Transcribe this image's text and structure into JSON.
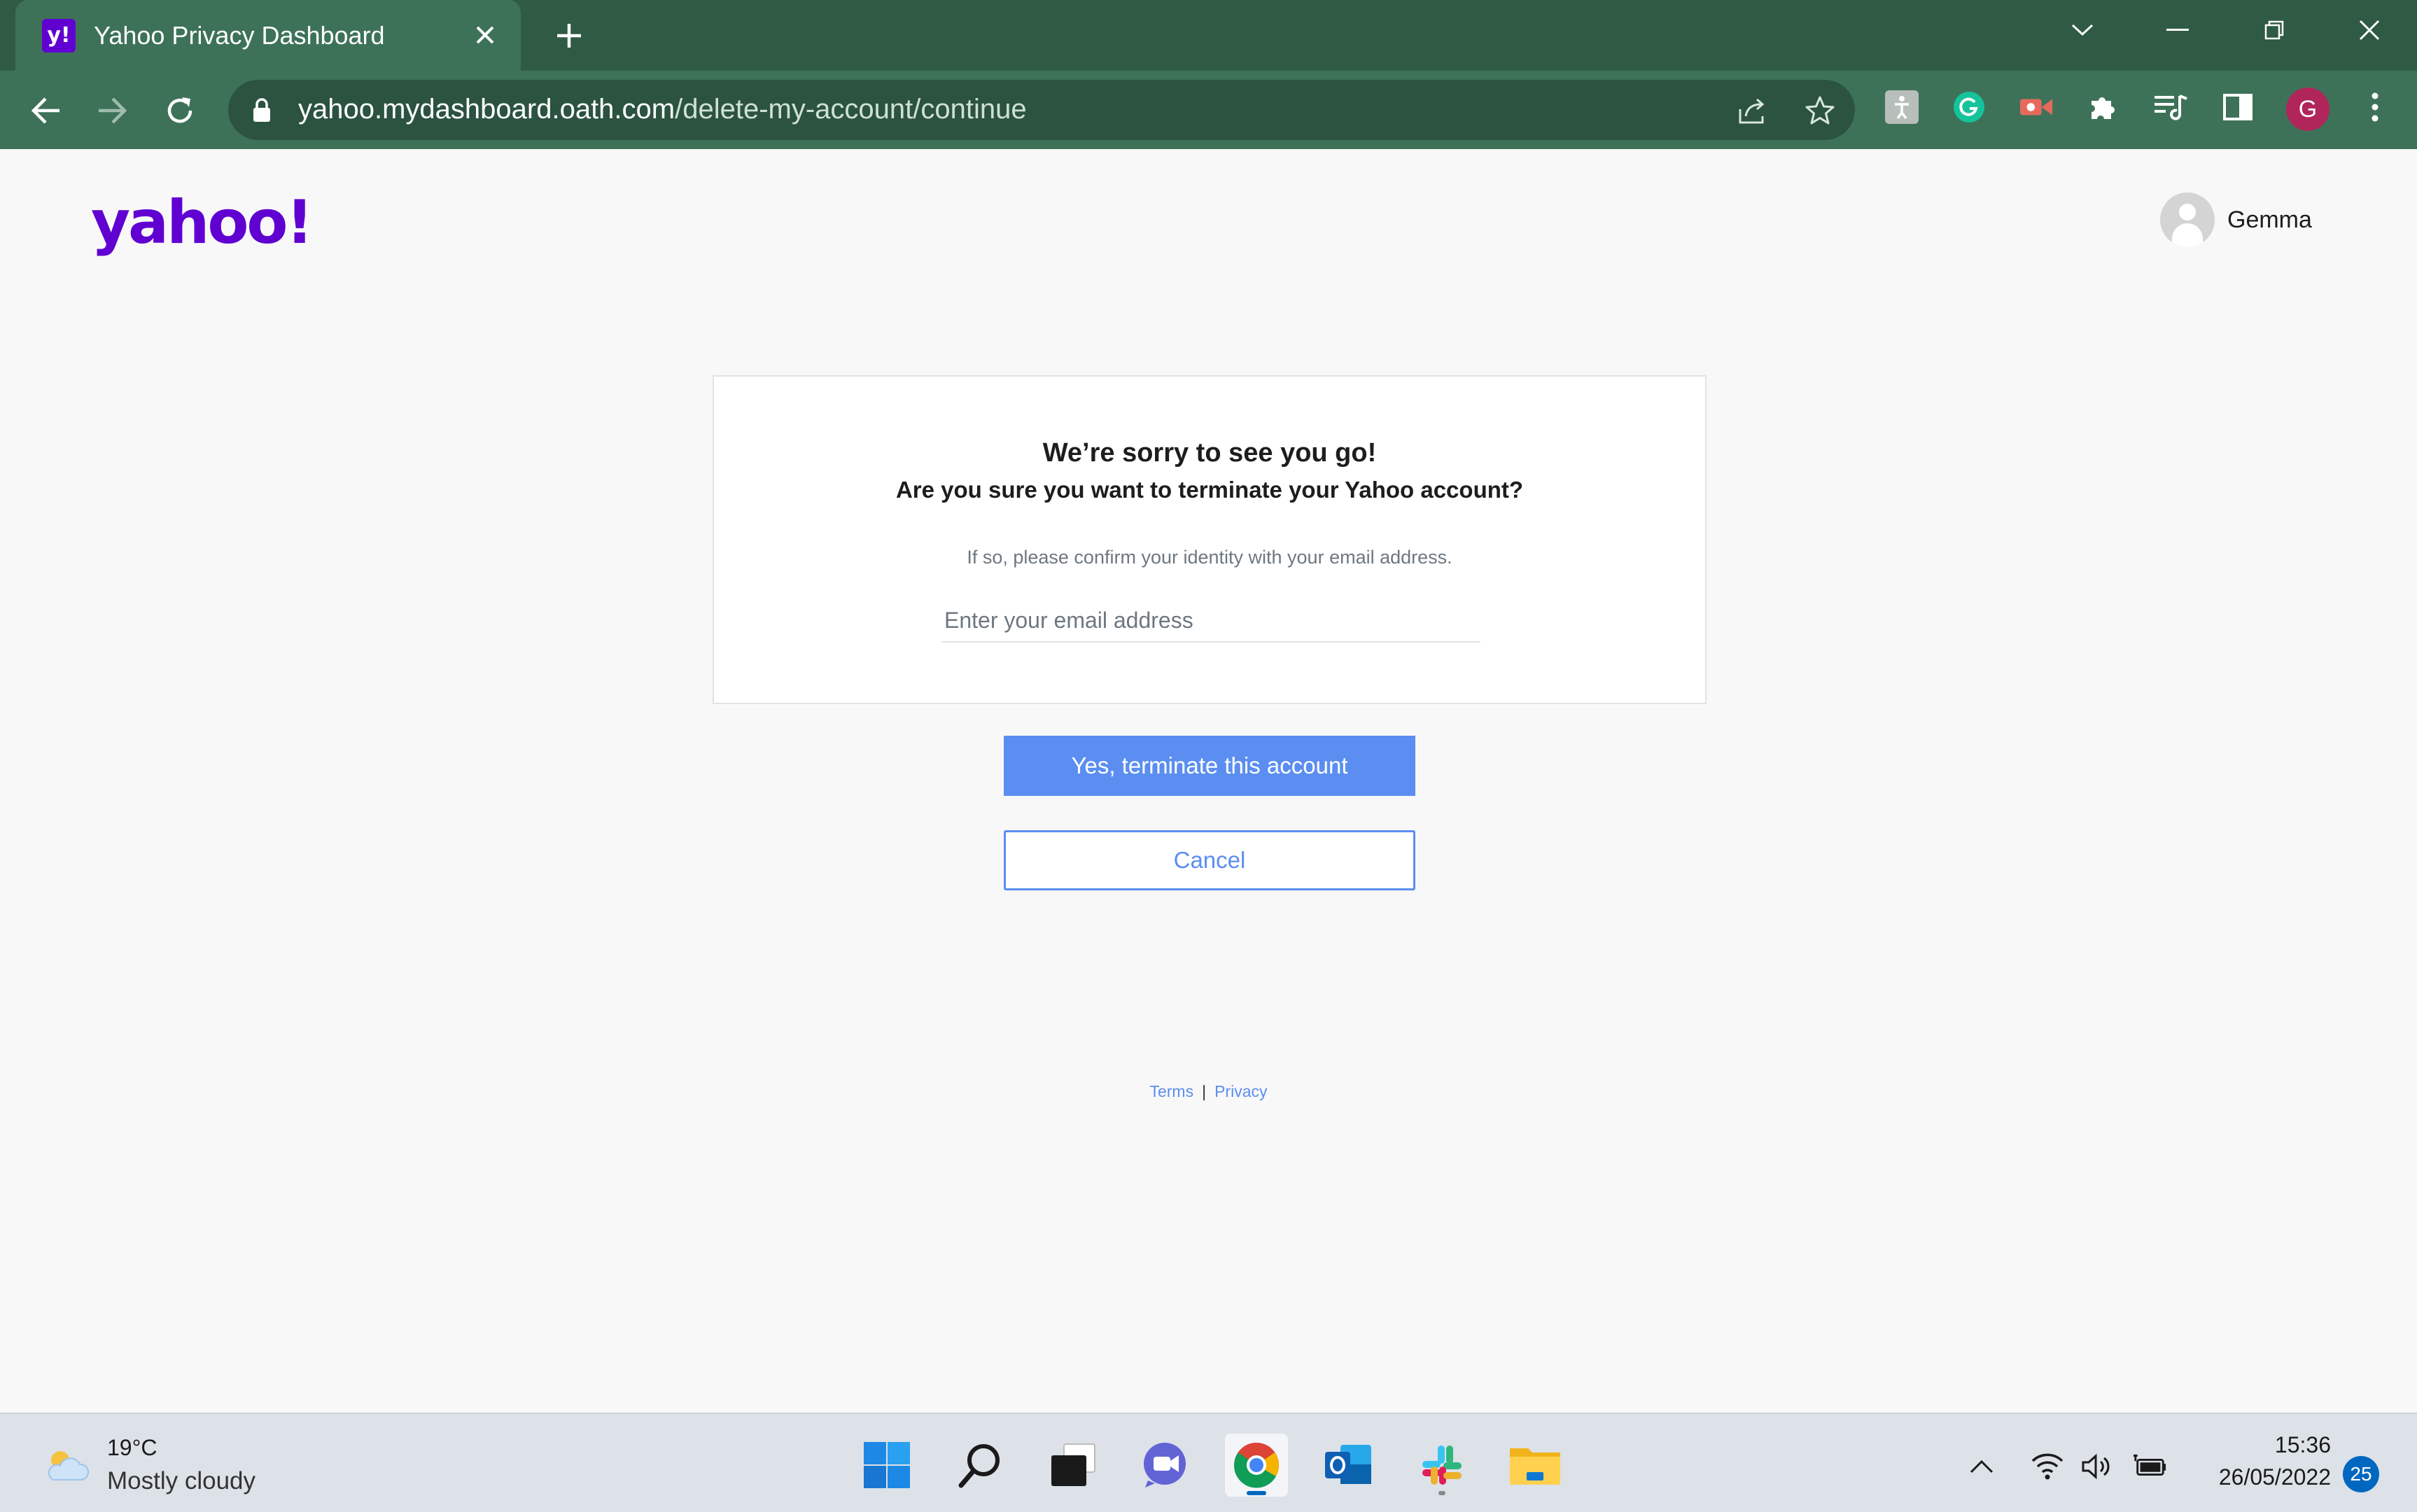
{
  "browser": {
    "tab": {
      "favicon_text": "y!",
      "title": "Yahoo Privacy Dashboard"
    },
    "url": {
      "domain": "yahoo.mydashboard.oath.com",
      "path": "/delete-my-account/continue"
    },
    "profile_initial": "G"
  },
  "page": {
    "logo": "yahoo!",
    "user_name": "Gemma",
    "heading": "We’re sorry to see you go!",
    "subheading": "Are you sure you want to terminate your Yahoo account?",
    "hint": "If so, please confirm your identity with your email address.",
    "email_placeholder": "Enter your email address",
    "confirm_label": "Yes, terminate this account",
    "cancel_label": "Cancel",
    "footer": {
      "terms": "Terms",
      "separator": "|",
      "privacy": "Privacy"
    }
  },
  "taskbar": {
    "weather": {
      "temp": "19°C",
      "condition": "Mostly cloudy"
    },
    "clock": {
      "time": "15:36",
      "date": "26/05/2022"
    },
    "notifications": "25"
  },
  "colors": {
    "brand": "#6001d2",
    "accent": "#5b8ef0",
    "chrome": "#3d7259",
    "tabbar": "#2f5a44"
  }
}
